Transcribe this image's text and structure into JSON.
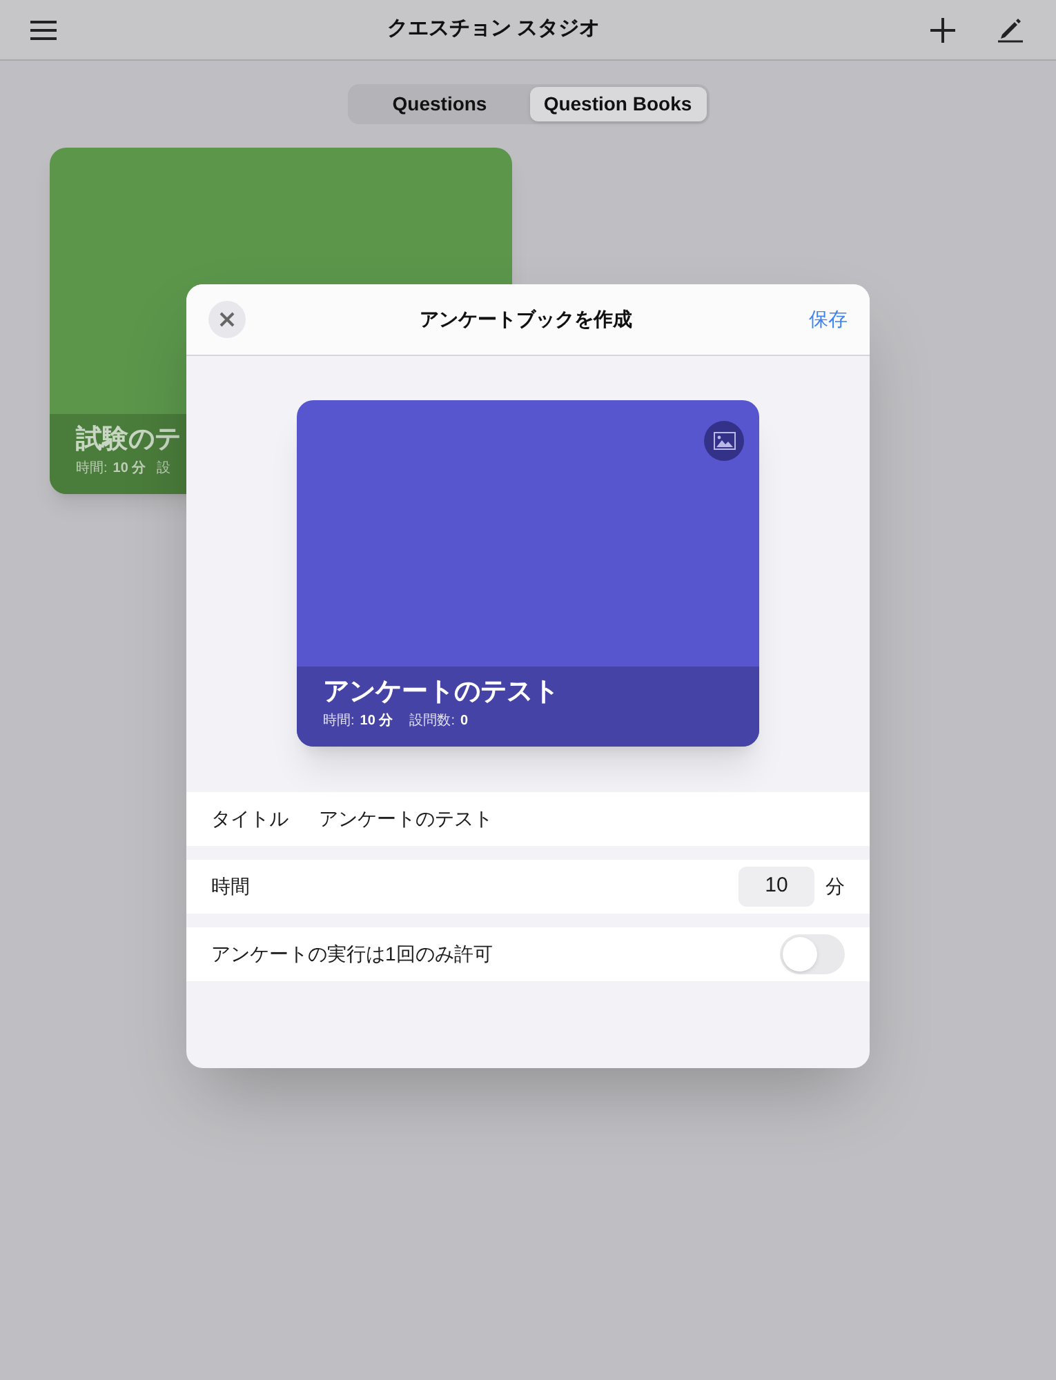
{
  "top_bar": {
    "title": "クエスチョン スタジオ"
  },
  "segments": [
    {
      "label": "Questions",
      "selected": false
    },
    {
      "label": "Question Books",
      "selected": true
    }
  ],
  "books": [
    {
      "title": "試験のテ",
      "time_label": "時間:",
      "time_value": "10 分",
      "count_label": "設"
    }
  ],
  "dialog": {
    "title": "アンケートブックを作成",
    "save": "保存",
    "preview": {
      "title": "アンケートのテスト",
      "time_label": "時間:",
      "time_value": "10 分",
      "count_label": "設問数:",
      "count_value": "0"
    },
    "fields": [
      {
        "kind": "text",
        "label": "タイトル",
        "value": "アンケートのテスト"
      },
      {
        "kind": "number",
        "label": "時間",
        "value": "10",
        "unit": "分"
      },
      {
        "kind": "toggle",
        "label": "アンケートの実行は1回のみ許可",
        "on": false
      }
    ]
  }
}
